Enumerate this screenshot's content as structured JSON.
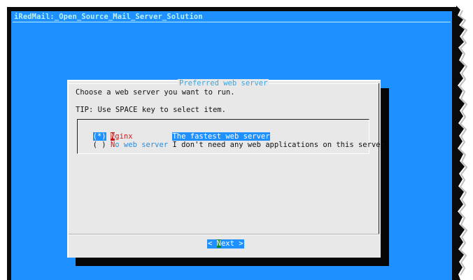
{
  "window": {
    "title": "iRedMail:_Open_Source_Mail_Server_Solution"
  },
  "dialog": {
    "title": "Preferred web server",
    "prompt": "Choose a web server you want to run.",
    "tip": "TIP: Use SPACE key to select item.",
    "options": [
      {
        "marker": "(*)",
        "hotkey": "N",
        "tag_rest": "ginx",
        "description": "The fastest web server",
        "selected": true
      },
      {
        "marker": "( )",
        "hotkey": "N",
        "tag_rest": "o web server",
        "description": "I don't need any web applications on this server",
        "selected": false
      }
    ],
    "button": {
      "left": "<",
      "hotkey": "N",
      "rest": "ext",
      "right": ">"
    }
  },
  "colors": {
    "terminal_background": "#1e90ff",
    "dialog_background": "#e8e8e8",
    "title_color": "#3aa6e0",
    "hotkey_red": "#d01818",
    "button_hotkey_green": "#0c8a2a"
  }
}
